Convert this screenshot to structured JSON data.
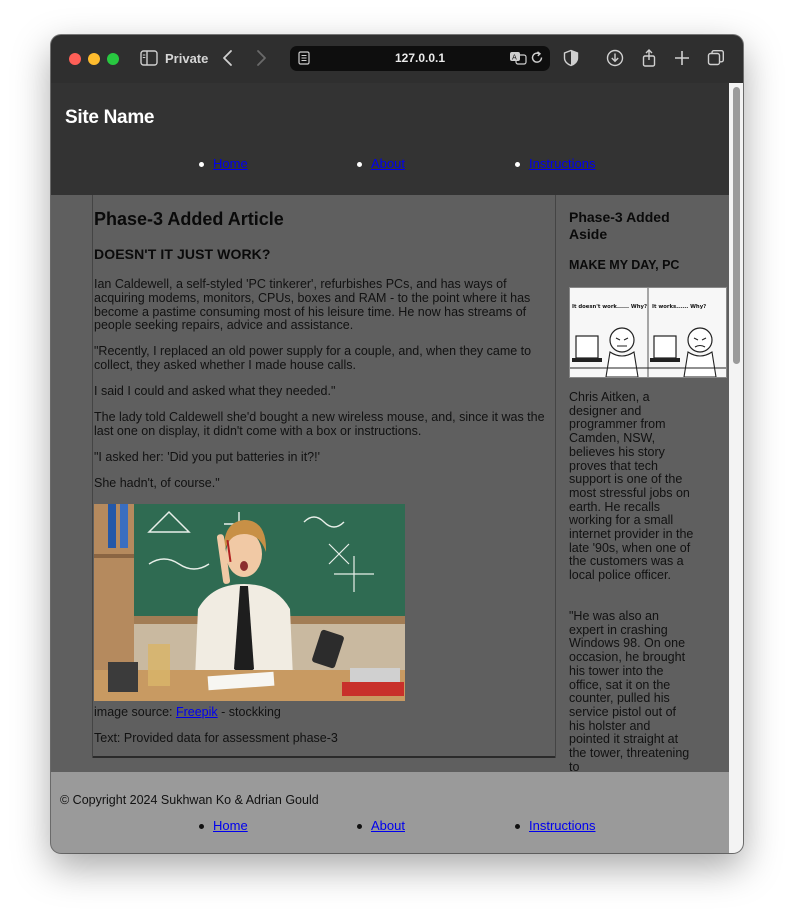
{
  "browser": {
    "private_label": "Private",
    "url": "127.0.0.1"
  },
  "site": {
    "name": "Site Name",
    "nav": [
      "Home",
      "About",
      "Instructions"
    ]
  },
  "article": {
    "title": "Phase-3 Added Article",
    "subtitle": "DOESN'T IT JUST WORK?",
    "paragraphs": [
      "Ian Caldewell, a self-styled 'PC tinkerer', refurbishes PCs, and has ways of acquiring modems, monitors, CPUs, boxes and RAM - to the point where it has become a pastime consuming most of his leisure time. He now has streams of people seeking repairs, advice and assistance.",
      "\"Recently, I replaced an old power supply for a couple, and, when they came to collect, they asked whether I made house calls.",
      "I said I could and asked what they needed.\"",
      "The lady told Caldewell she'd bought a new wireless mouse, and, since it was the last one on display, it didn't come with a box or instructions.",
      "\"I asked her: 'Did you put batteries in it?!'",
      "She hadn't, of course.\""
    ],
    "image_source_prefix": "image source: ",
    "image_source_link": "Freepik",
    "image_source_suffix": " - stockking",
    "text_credit": "Text: Provided data for assessment phase-3"
  },
  "aside": {
    "title": "Phase-3 Added Aside",
    "subtitle": "MAKE MY DAY, PC",
    "comic_left": "It doesn't work...... Why?",
    "comic_right": "It works...... Why?",
    "paragraphs": [
      "Chris Aitken, a designer and programmer from Camden, NSW, believes his story proves that tech support is one of the most stressful jobs on earth. He recalls working for a small internet provider in the late '90s, when one of the customers was a local police officer.",
      "\"He was also an expert in crashing Windows 98. On one occasion, he brought his tower into the office, sat it on the counter, pulled his service pistol out of his holster and pointed it straight at the tower, threatening to"
    ]
  },
  "footer": {
    "copyright": "© Copyright 2024 Sukhwan Ko & Adrian Gould",
    "nav": [
      "Home",
      "About",
      "Instructions"
    ]
  },
  "colors": {
    "header_bg": "#333333",
    "page_bg": "#5f5f5f",
    "footer_bg": "#9a9a9a",
    "link": "#0000ee"
  }
}
